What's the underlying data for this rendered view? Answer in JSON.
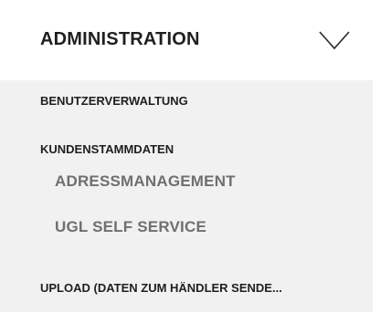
{
  "menu": {
    "title": "ADMINISTRATION",
    "toggle_icon": "chevron-down-icon",
    "items": [
      {
        "label": "BENUTZERVERWALTUNG"
      },
      {
        "label": "KUNDENSTAMMDATEN",
        "subitems": [
          {
            "label": "ADRESSMANAGEMENT"
          },
          {
            "label": "UGL SELF SERVICE"
          }
        ]
      },
      {
        "label": "UPLOAD (DATEN ZUM HÄNDLER SENDE..."
      }
    ]
  },
  "colors": {
    "panel_background": "#f1f1f1",
    "header_background": "#ffffff",
    "primary_text": "#1f1f1f",
    "secondary_text": "#6f6f6f"
  }
}
